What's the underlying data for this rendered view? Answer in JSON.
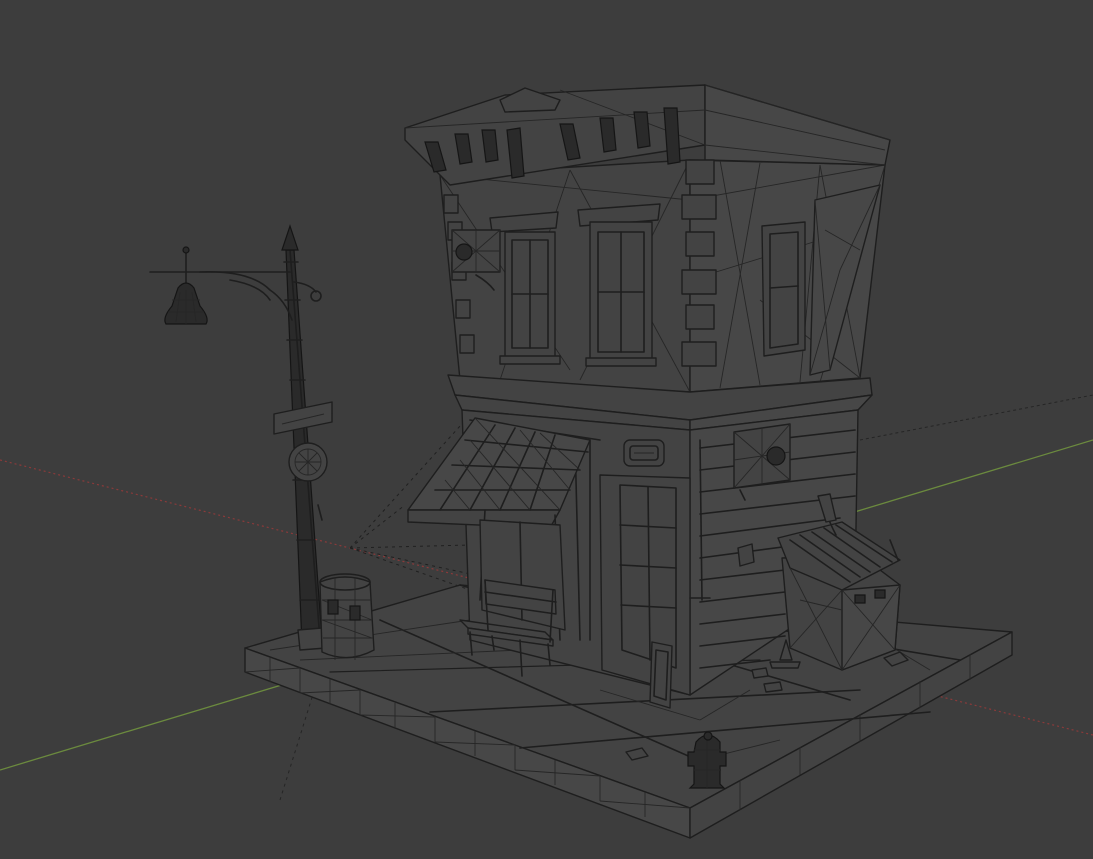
{
  "viewport": {
    "background": "#3d3d3d",
    "axis_x_color": "#8a3a3a",
    "axis_y_color": "#6b8a3e",
    "wire_color": "#1e1e1e"
  },
  "scene": {
    "objects": [
      "street-lamp",
      "building",
      "awning",
      "bench",
      "barrel",
      "dumpster",
      "fire-hydrant",
      "sidewalk-base",
      "sign-board"
    ]
  }
}
